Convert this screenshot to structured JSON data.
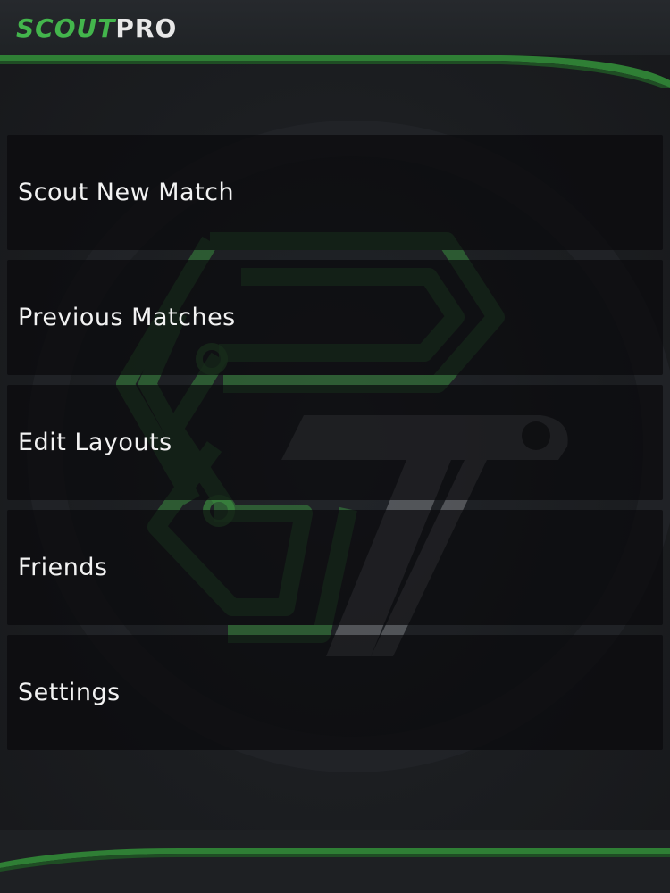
{
  "app": {
    "brand_scout": "SCOUT",
    "brand_pro": "PRO",
    "accent_color": "#43b54c",
    "logo_name": "pt-logo-icon"
  },
  "menu": {
    "items": [
      {
        "label": "Scout New Match"
      },
      {
        "label": "Previous Matches"
      },
      {
        "label": "Edit Layouts"
      },
      {
        "label": "Friends"
      },
      {
        "label": "Settings"
      }
    ]
  }
}
